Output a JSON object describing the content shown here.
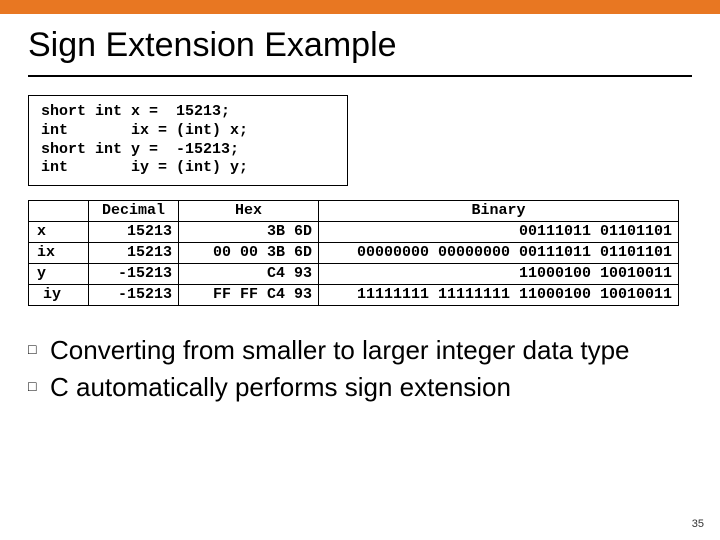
{
  "title": "Sign Extension Example",
  "code": "short int x =  15213;\nint       ix = (int) x;\nshort int y =  -15213;\nint       iy = (int) y;",
  "table": {
    "headers": {
      "dec": "Decimal",
      "hex": "Hex",
      "bin": "Binary"
    },
    "rows": [
      {
        "name": "x",
        "dec": "15213",
        "hex": "3B 6D",
        "bin": "00111011 01101101"
      },
      {
        "name": "ix",
        "dec": "15213",
        "hex": "00 00 3B 6D",
        "bin": "00000000 00000000 00111011 01101101"
      },
      {
        "name": "y",
        "dec": "-15213",
        "hex": "C4 93",
        "bin": "11000100 10010011"
      },
      {
        "name": "iy",
        "dec": "-15213",
        "hex": "FF FF C4 93",
        "bin": "11111111 11111111 11000100 10010011"
      }
    ]
  },
  "bullets": [
    "Converting from smaller to larger integer data type",
    "C automatically performs sign extension"
  ],
  "page_number": "35"
}
